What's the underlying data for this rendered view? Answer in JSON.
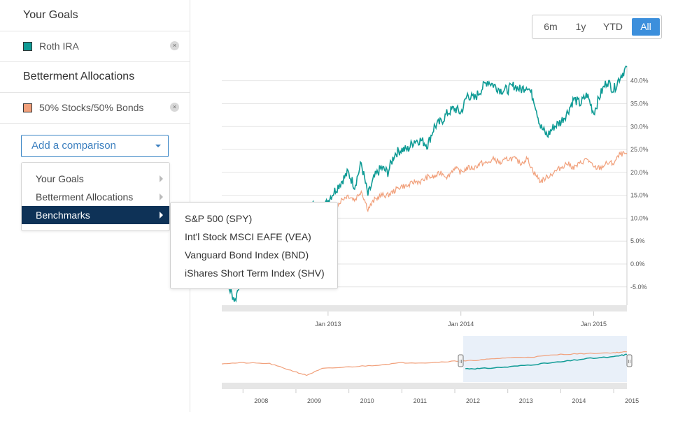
{
  "sidebar": {
    "goals_heading": "Your Goals",
    "goal_item": {
      "label": "Roth IRA",
      "color": "#0f9b95",
      "remove": "×"
    },
    "allocations_heading": "Betterment Allocations",
    "allocation_item": {
      "label": "50% Stocks/50% Bonds",
      "color": "#f1a07b",
      "remove": "×"
    },
    "add_comparison_label": "Add a comparison"
  },
  "menu": {
    "items": [
      {
        "label": "Your Goals"
      },
      {
        "label": "Betterment Allocations"
      },
      {
        "label": "Benchmarks"
      }
    ],
    "active_index": 2,
    "submenu": [
      {
        "label": "S&P 500 (SPY)"
      },
      {
        "label": "Int'l Stock MSCI EAFE (VEA)"
      },
      {
        "label": "Vanguard Bond Index (BND)"
      },
      {
        "label": "iShares Short Term Index (SHV)"
      }
    ]
  },
  "range_buttons": {
    "options": [
      "6m",
      "1y",
      "YTD",
      "All"
    ],
    "selected": "All"
  },
  "chart_data": {
    "type": "line",
    "ylim": [
      -9,
      43
    ],
    "xlim": [
      2012.2,
      2015.25
    ],
    "y_ticks": [
      {
        "v": 40,
        "label": "40.0%"
      },
      {
        "v": 35,
        "label": "35.0%"
      },
      {
        "v": 30,
        "label": "30.0%"
      },
      {
        "v": 25,
        "label": "25.0%"
      },
      {
        "v": 20,
        "label": "20.0%"
      },
      {
        "v": 15,
        "label": "15.0%"
      },
      {
        "v": 10,
        "label": "10.0%"
      },
      {
        "v": 5,
        "label": "5.0%"
      },
      {
        "v": 0,
        "label": "0.0%"
      },
      {
        "v": -5,
        "label": "-5.0%"
      }
    ],
    "x_ticks": [
      {
        "v": 2013.0,
        "label": "Jan 2013"
      },
      {
        "v": 2014.0,
        "label": "Jan 2014"
      },
      {
        "v": 2015.0,
        "label": "Jan 2015"
      }
    ],
    "series": [
      {
        "name": "Roth IRA",
        "color": "#0f9b95",
        "x": [
          2012.22,
          2012.25,
          2012.3,
          2012.35,
          2012.42,
          2012.5,
          2012.55,
          2012.6,
          2012.65,
          2012.7,
          2012.75,
          2012.8,
          2012.85,
          2012.9,
          2012.95,
          2013.0,
          2013.05,
          2013.1,
          2013.15,
          2013.2,
          2013.25,
          2013.3,
          2013.35,
          2013.4,
          2013.45,
          2013.5,
          2013.55,
          2013.6,
          2013.65,
          2013.7,
          2013.75,
          2013.8,
          2013.85,
          2013.9,
          2013.95,
          2014.0,
          2014.05,
          2014.1,
          2014.15,
          2014.2,
          2014.25,
          2014.3,
          2014.35,
          2014.4,
          2014.45,
          2014.5,
          2014.55,
          2014.6,
          2014.65,
          2014.7,
          2014.75,
          2014.8,
          2014.85,
          2014.9,
          2014.95,
          2015.0,
          2015.05,
          2015.1,
          2015.15,
          2015.2,
          2015.25
        ],
        "y": [
          -1,
          -5,
          -8,
          -2,
          3,
          7,
          10,
          9,
          6,
          8,
          10,
          11,
          12,
          13,
          11,
          14,
          16,
          18,
          20,
          17,
          22,
          15,
          19,
          21,
          20,
          24,
          25,
          25,
          27,
          27,
          26,
          30,
          31,
          33,
          34,
          33,
          37,
          36,
          38,
          40,
          39,
          38,
          38,
          39,
          38,
          39,
          36,
          30,
          28,
          30,
          31,
          33,
          36,
          35,
          37,
          33,
          37,
          40,
          38,
          41,
          43
        ]
      },
      {
        "name": "50% Stocks/50% Bonds",
        "color": "#f1a07b",
        "x": [
          2012.22,
          2012.3,
          2012.4,
          2012.5,
          2012.55,
          2012.6,
          2012.65,
          2012.7,
          2012.75,
          2012.8,
          2012.85,
          2012.9,
          2012.95,
          2013.0,
          2013.05,
          2013.1,
          2013.15,
          2013.2,
          2013.25,
          2013.3,
          2013.35,
          2013.4,
          2013.45,
          2013.5,
          2013.55,
          2013.6,
          2013.65,
          2013.7,
          2013.75,
          2013.8,
          2013.85,
          2013.9,
          2013.95,
          2014.0,
          2014.05,
          2014.1,
          2014.15,
          2014.2,
          2014.25,
          2014.3,
          2014.35,
          2014.4,
          2014.45,
          2014.5,
          2014.55,
          2014.6,
          2014.65,
          2014.7,
          2014.75,
          2014.8,
          2014.85,
          2014.9,
          2014.95,
          2015.0,
          2015.05,
          2015.1,
          2015.15,
          2015.2,
          2015.25
        ],
        "y": [
          3,
          4,
          6,
          8,
          9,
          8,
          9,
          10,
          9,
          9,
          10,
          11,
          12,
          11,
          12,
          14,
          15,
          14,
          16,
          12,
          14,
          15,
          15,
          16,
          17,
          17,
          18,
          18,
          19,
          19,
          20,
          19,
          21,
          20,
          21,
          21,
          22,
          22,
          23,
          22,
          23,
          23,
          22,
          23,
          20,
          18,
          19,
          20,
          21,
          22,
          21,
          22,
          23,
          21,
          21,
          22,
          22,
          24,
          24
        ]
      }
    ]
  },
  "navigator": {
    "year_labels": [
      "2008",
      "2009",
      "2010",
      "2011",
      "2012",
      "2013",
      "2014",
      "2015"
    ],
    "grip_label": "II"
  }
}
